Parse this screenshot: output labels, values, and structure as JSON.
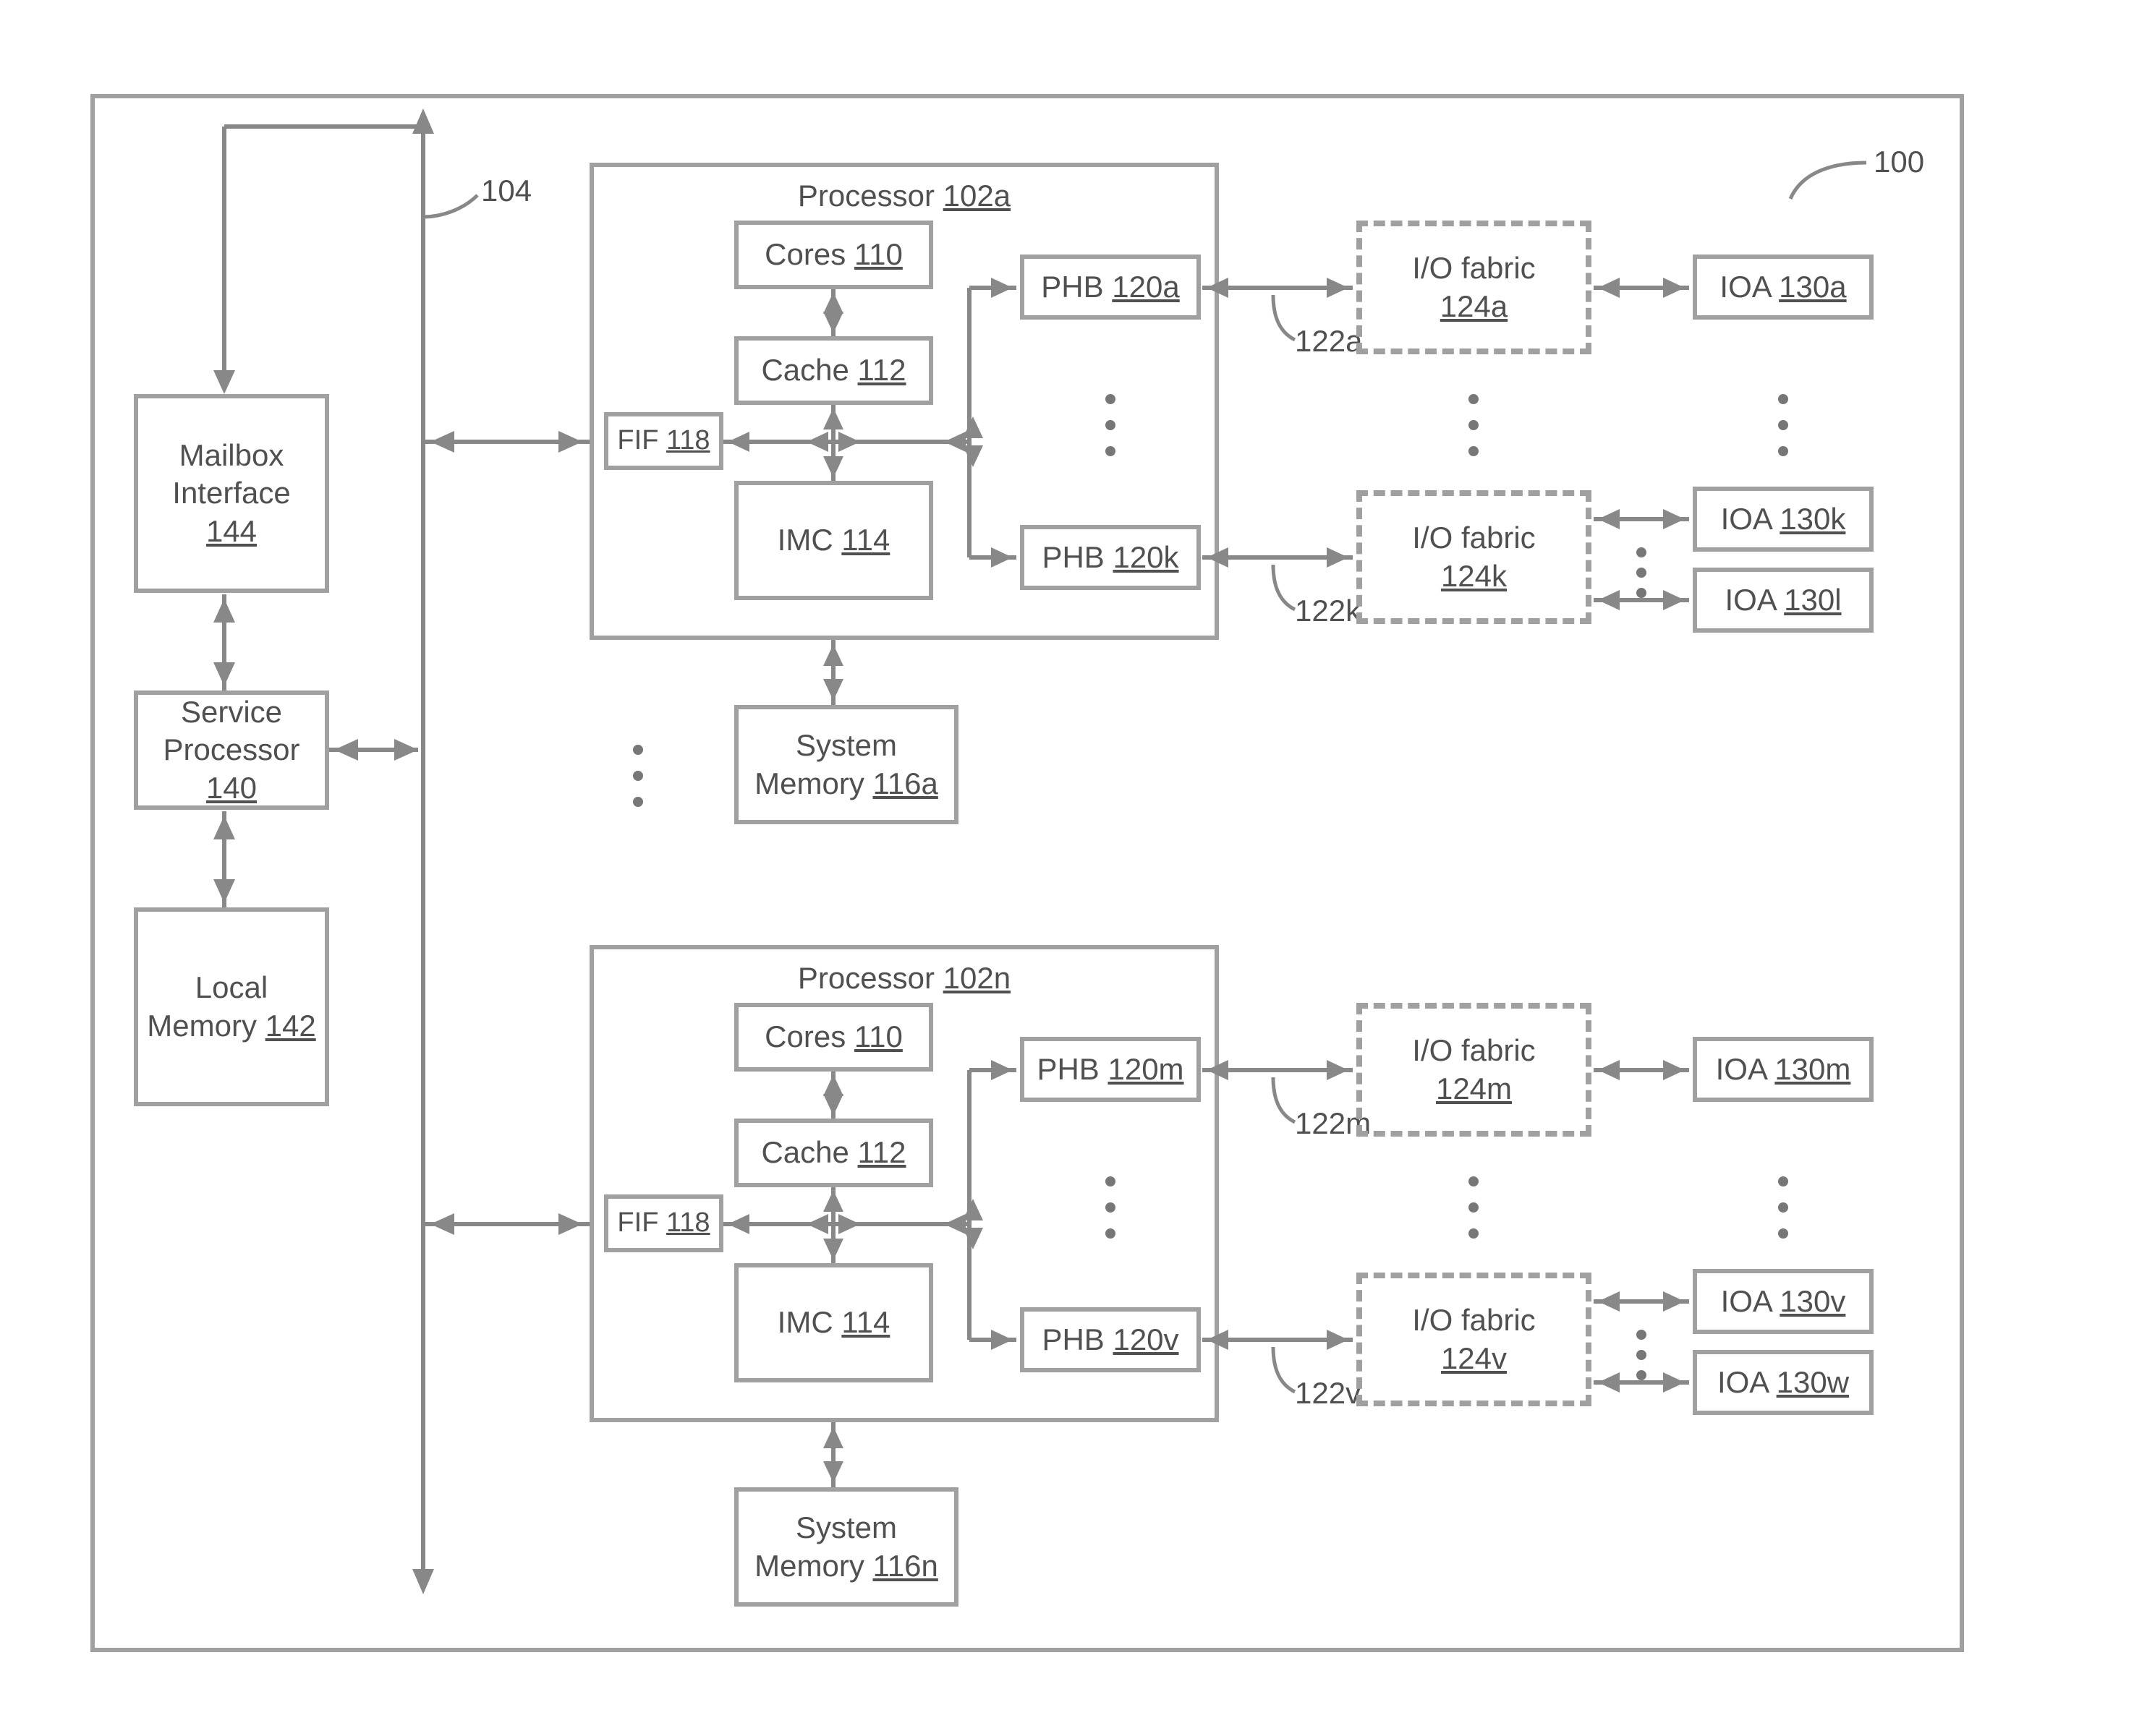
{
  "figure_ref": "100",
  "bus_ref": "104",
  "mailbox": {
    "line1": "Mailbox",
    "line2": "Interface",
    "ref": "144"
  },
  "service_proc": {
    "line1": "Service",
    "line2": "Processor",
    "ref": "140"
  },
  "local_mem": {
    "line1": "Local",
    "line2": "Memory",
    "ref": "142"
  },
  "processors": {
    "a": {
      "title": "Processor",
      "ref": "102a",
      "cores": {
        "label": "Cores",
        "ref": "110"
      },
      "cache": {
        "label": "Cache",
        "ref": "112"
      },
      "fif": {
        "label": "FIF",
        "ref": "118"
      },
      "imc": {
        "label": "IMC",
        "ref": "114"
      },
      "sysmem": {
        "line1": "System",
        "line2": "Memory",
        "ref": "116a"
      },
      "phb_top": {
        "label": "PHB",
        "ref": "120a"
      },
      "phb_bot": {
        "label": "PHB",
        "ref": "120k"
      },
      "link_top": "122a",
      "link_bot": "122k",
      "fabric_top": {
        "line1": "I/O fabric",
        "ref": "124a"
      },
      "fabric_bot": {
        "line1": "I/O fabric",
        "ref": "124k"
      },
      "ioa_a": {
        "label": "IOA",
        "ref": "130a"
      },
      "ioa_k": {
        "label": "IOA",
        "ref": "130k"
      },
      "ioa_l": {
        "label": "IOA",
        "ref": "130l"
      }
    },
    "n": {
      "title": "Processor",
      "ref": "102n",
      "cores": {
        "label": "Cores",
        "ref": "110"
      },
      "cache": {
        "label": "Cache",
        "ref": "112"
      },
      "fif": {
        "label": "FIF",
        "ref": "118"
      },
      "imc": {
        "label": "IMC",
        "ref": "114"
      },
      "sysmem": {
        "line1": "System",
        "line2": "Memory",
        "ref": "116n"
      },
      "phb_top": {
        "label": "PHB",
        "ref": "120m"
      },
      "phb_bot": {
        "label": "PHB",
        "ref": "120v"
      },
      "link_top": "122m",
      "link_bot": "122v",
      "fabric_top": {
        "line1": "I/O fabric",
        "ref": "124m"
      },
      "fabric_bot": {
        "line1": "I/O fabric",
        "ref": "124v"
      },
      "ioa_m": {
        "label": "IOA",
        "ref": "130m"
      },
      "ioa_v": {
        "label": "IOA",
        "ref": "130v"
      },
      "ioa_w": {
        "label": "IOA",
        "ref": "130w"
      }
    }
  }
}
